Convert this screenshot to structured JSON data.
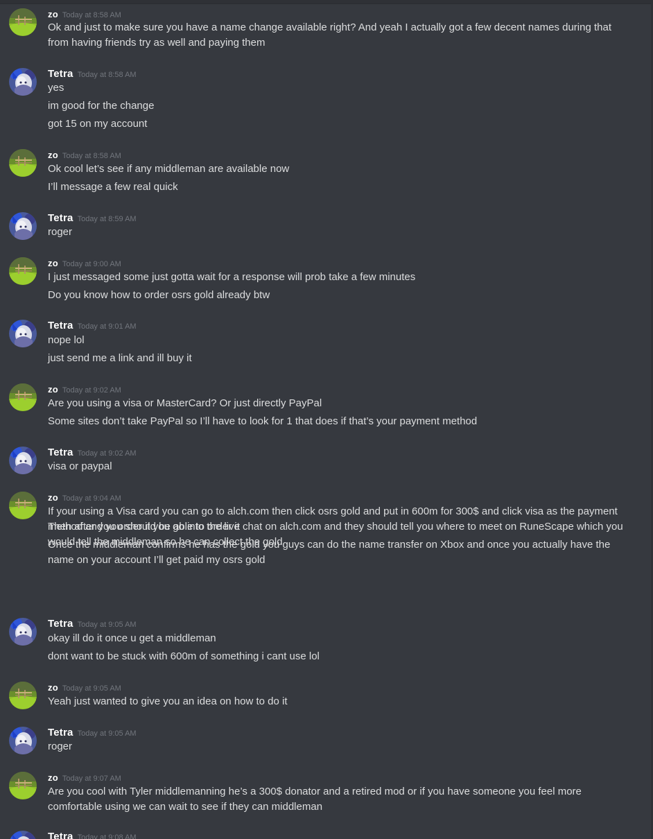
{
  "users": {
    "zo": {
      "name": "zo",
      "avatar": "grass-field-avatar"
    },
    "tetra": {
      "name": "Tetra",
      "avatar": "blue-anime-avatar"
    }
  },
  "messages": [
    {
      "author": "zo",
      "time": "Today at 8:58 AM",
      "lines": [
        "Ok and just to make sure you have a name change available right? And yeah I actually got a few decent names during that from having friends try as well and paying them"
      ]
    },
    {
      "author": "Tetra",
      "time": "Today at 8:58 AM",
      "lines": [
        "yes",
        "im good for the change",
        "got 15 on my account"
      ]
    },
    {
      "author": "zo",
      "time": "Today at 8:58 AM",
      "lines": [
        "Ok cool let’s see if any middleman are available now",
        "I’ll message a few real quick"
      ]
    },
    {
      "author": "Tetra",
      "time": "Today at 8:59 AM",
      "lines": [
        "roger"
      ]
    },
    {
      "author": "zo",
      "time": "Today at 9:00 AM",
      "lines": [
        "I just messaged some just gotta wait for a response will prob take a few minutes",
        "Do you know how to order osrs gold already btw"
      ]
    },
    {
      "author": "Tetra",
      "time": "Today at 9:01 AM",
      "lines": [
        "nope lol",
        "just send me a link and ill buy it"
      ]
    },
    {
      "author": "zo",
      "time": "Today at 9:02 AM",
      "lines": [
        "Are you using a visa or MasterCard? Or just directly PayPal",
        "Some sites don’t take PayPal so I’ll have to look for 1 that does if that’s your payment method"
      ]
    },
    {
      "author": "Tetra",
      "time": "Today at 9:02 AM",
      "lines": [
        "visa or paypal"
      ]
    },
    {
      "author": "zo",
      "time": "Today at 9:04 AM",
      "lines": [
        "If your using a Visa card you can go to alch.com then click osrs gold and put in 600m for 300$ and click visa as the payment method and you should be able to order it",
        "Then after you order it you go into the live chat on alch.com and they should tell you where to meet on RuneScape which you would tell the middleman so he can collect the gold",
        "Once the middleman confirms he has the gold you guys can do the name transfer on Xbox and once you actually have the name on your account I’ll get paid my osrs gold"
      ]
    },
    {
      "author": "Tetra",
      "time": "Today at 9:05 AM",
      "lines": [
        "okay ill do it once u get a middleman",
        "dont want to be stuck with 600m of something i cant use lol"
      ]
    },
    {
      "author": "zo",
      "time": "Today at 9:05 AM",
      "lines": [
        "Yeah just wanted to give you an idea on how to do it"
      ]
    },
    {
      "author": "Tetra",
      "time": "Today at 9:05 AM",
      "lines": [
        "roger"
      ]
    },
    {
      "author": "zo",
      "time": "Today at 9:07 AM",
      "lines": [
        "Are you cool with Tyler middlemanning he’s a 300$ donator and a retired mod or if you have someone you feel more comfortable using we can wait to see if they can middleman"
      ]
    },
    {
      "author": "Tetra",
      "time": "Today at 9:08 AM",
      "lines": []
    }
  ]
}
